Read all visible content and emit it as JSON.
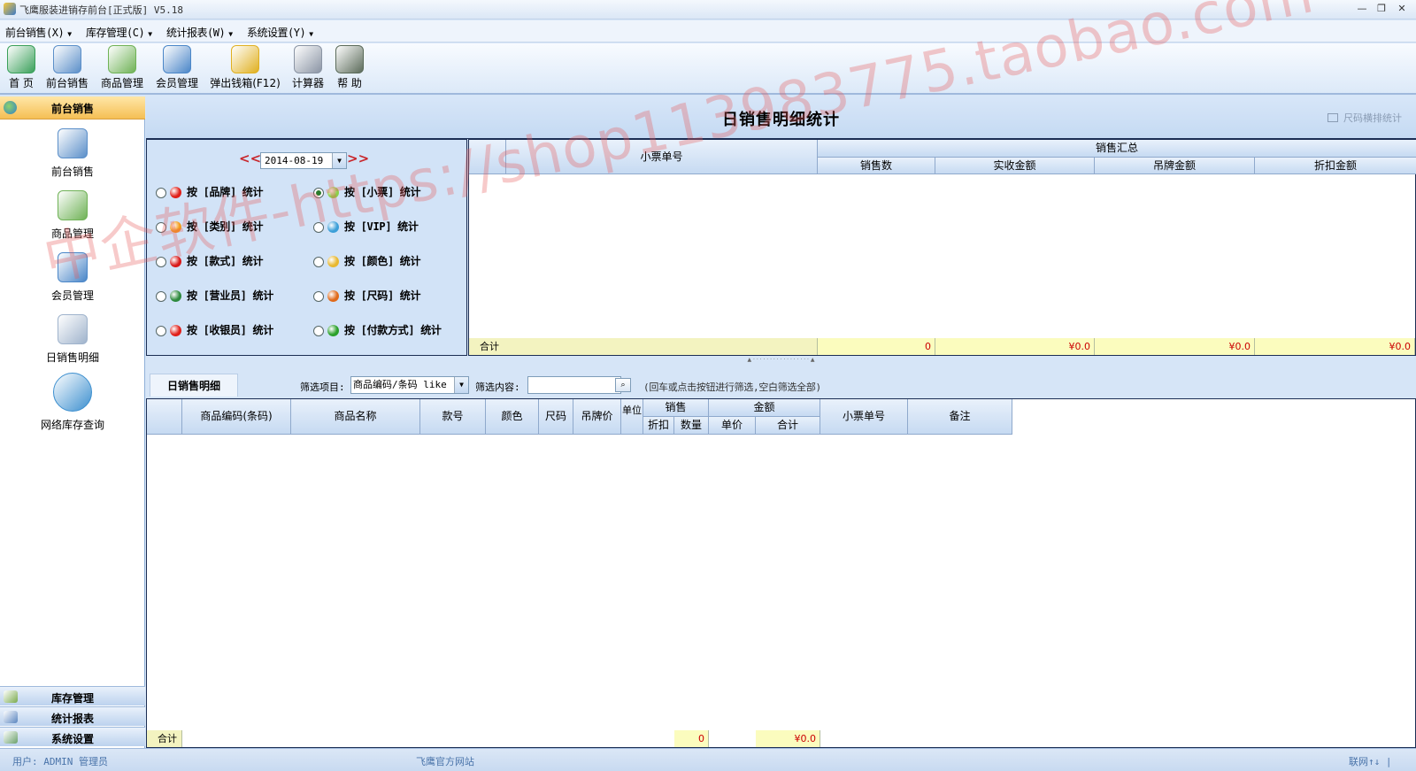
{
  "window": {
    "title": "飞鹰服装进销存前台[正式版] V5.18",
    "minimize": "—",
    "restore": "❐",
    "close": "✕"
  },
  "menu": [
    "前台销售(X)",
    "库存管理(C)",
    "统计报表(W)",
    "系统设置(Y)"
  ],
  "toolbar": [
    {
      "label": "首 页",
      "icon": "home-icon",
      "color": "#3aa05a"
    },
    {
      "label": "前台销售",
      "icon": "sales-ledger-icon",
      "color": "#5b8fc9"
    },
    {
      "label": "商品管理",
      "icon": "product-grid-icon",
      "color": "#6fb256"
    },
    {
      "label": "会员管理",
      "icon": "members-icon",
      "color": "#4a86c8"
    },
    {
      "label": "弹出钱箱(F12)",
      "icon": "coins-icon",
      "color": "#e0b020"
    },
    {
      "label": "计算器",
      "icon": "calculator-icon",
      "color": "#8a94a4"
    },
    {
      "label": "帮 助",
      "icon": "help-icon",
      "color": "#5b6b5a"
    }
  ],
  "sidebar": {
    "header": "前台销售",
    "items": [
      {
        "label": "前台销售",
        "icon": "sales-ledger-icon",
        "color": "#5b8fc9"
      },
      {
        "label": "商品管理",
        "icon": "product-grid-icon",
        "color": "#6fb256"
      },
      {
        "label": "会员管理",
        "icon": "members-icon",
        "color": "#4a86c8"
      },
      {
        "label": "日销售明细",
        "icon": "daily-detail-icon",
        "color": "#9fb3cc"
      },
      {
        "label": "网络库存查询",
        "icon": "magnifier-icon",
        "color": "#3c8fcf"
      }
    ],
    "footer": [
      {
        "label": "库存管理",
        "icon": "inventory-icon",
        "color": "#7aaa4c"
      },
      {
        "label": "统计报表",
        "icon": "report-truck-icon",
        "color": "#5a86c0"
      },
      {
        "label": "系统设置",
        "icon": "settings-icon",
        "color": "#6aa06a"
      }
    ]
  },
  "page": {
    "title": "日销售明细统计",
    "extra": "尺码横排统计"
  },
  "date": {
    "prev": "<<",
    "value": "2014-08-19",
    "next": ">>"
  },
  "options": [
    {
      "label": "按 [品牌] 统计",
      "color": "#e0201a",
      "selected": false
    },
    {
      "label": "按 [小票] 统计",
      "color": "#8ccf4a",
      "selected": true
    },
    {
      "label": "按 [类别] 统计",
      "color": "#f39a18",
      "selected": false
    },
    {
      "label": "按 [VIP] 统计",
      "color": "#3c9fd8",
      "selected": false
    },
    {
      "label": "按 [款式] 统计",
      "color": "#d81a1a",
      "selected": false
    },
    {
      "label": "按 [颜色] 统计",
      "color": "#e8b830",
      "selected": false
    },
    {
      "label": "按 [营业员] 统计",
      "color": "#2e8a3e",
      "selected": false
    },
    {
      "label": "按 [尺码] 统计",
      "color": "#e06a1a",
      "selected": false
    },
    {
      "label": "按 [收银员] 统计",
      "color": "#e0201a",
      "selected": false
    },
    {
      "label": "按 [付款方式] 统计",
      "color": "#2aa02a",
      "selected": false
    }
  ],
  "summary": {
    "col_ticket": "小票单号",
    "group": "销售汇总",
    "cols": [
      "销售数",
      "实收金额",
      "吊牌金额",
      "折扣金额"
    ],
    "total_label": "合计",
    "totals": [
      "0",
      "¥0.0",
      "¥0.0",
      "¥0.0"
    ]
  },
  "detail": {
    "tab": "日销售明细",
    "filter_label": "筛选项目:",
    "filter_value": "商品编码/条码 like",
    "content_label": "筛选内容:",
    "content_value": "",
    "hint": "(回车或点击按钮进行筛选,空白筛选全部)",
    "cols": [
      "商品编码(条码)",
      "商品名称",
      "款号",
      "颜色",
      "尺码",
      "吊牌价",
      "单位"
    ],
    "sale_group": "销售",
    "sale_cols": [
      "折扣",
      "数量"
    ],
    "amount_group": "金额",
    "amount_cols": [
      "单价",
      "合计"
    ],
    "tail_cols": [
      "小票单号",
      "备注"
    ],
    "total_label": "合计",
    "total_qty": "0",
    "total_amount": "¥0.0"
  },
  "status": {
    "user": "用户: ADMIN 管理员",
    "site": "飞鹰官方网站",
    "net": "联网↑↓ |"
  },
  "watermark": "中企软件-https://shop113983775.taobao.com"
}
